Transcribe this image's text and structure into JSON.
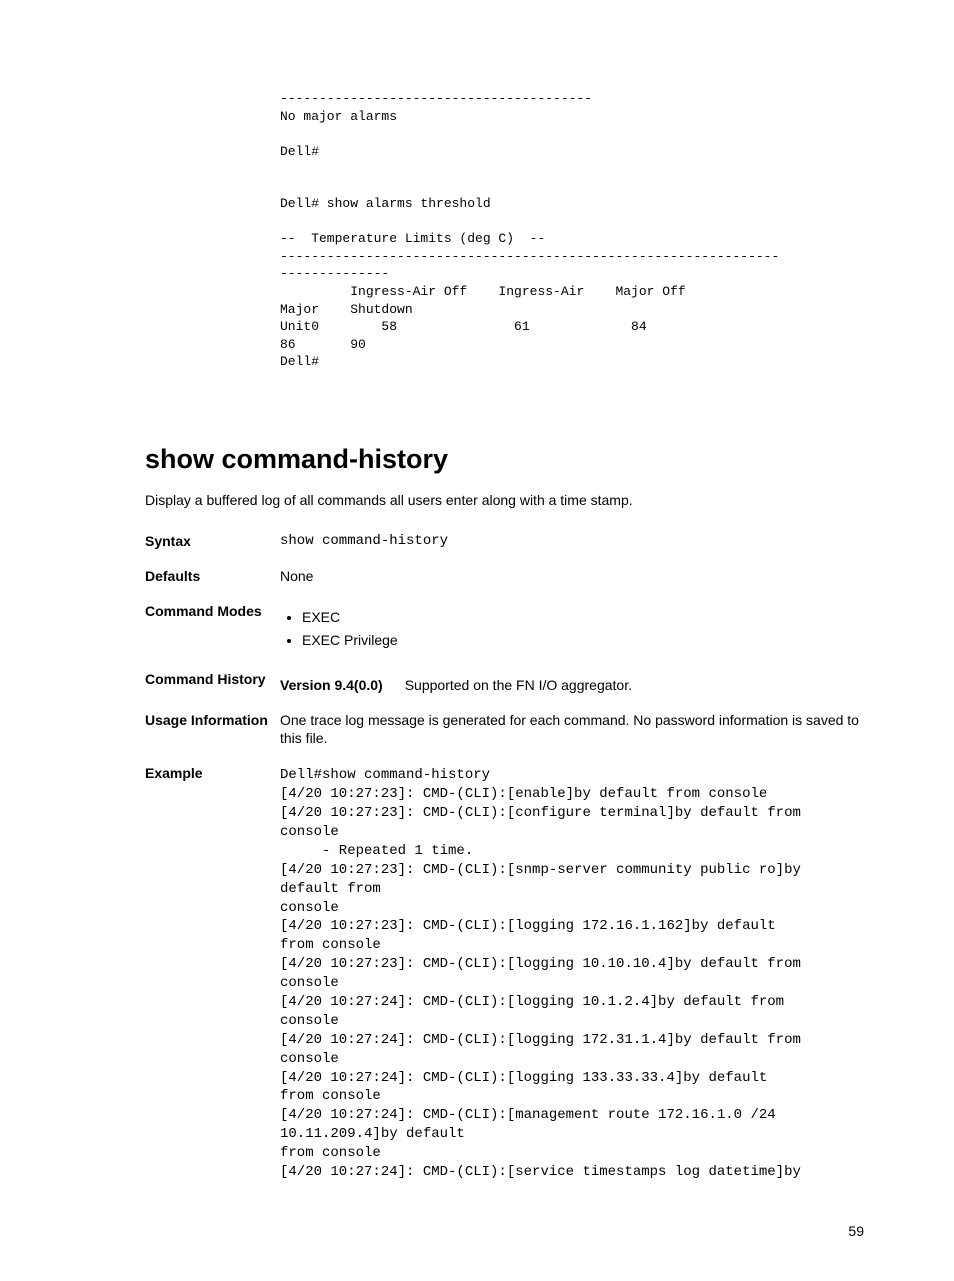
{
  "top_example": "----------------------------------------\nNo major alarms\n\nDell#\n\n\nDell# show alarms threshold\n\n--  Temperature Limits (deg C)  --\n----------------------------------------------------------------\n--------------\n         Ingress-Air Off    Ingress-Air    Major Off    \nMajor    Shutdown\nUnit0        58               61             84         \n86       90\nDell#",
  "section": {
    "title": "show command-history",
    "description": "Display a buffered log of all commands all users enter along with a time stamp."
  },
  "defs": {
    "syntax_label": "Syntax",
    "syntax_value": "show command-history",
    "defaults_label": "Defaults",
    "defaults_value": "None",
    "modes_label": "Command Modes",
    "modes_items": [
      "EXEC",
      "EXEC Privilege"
    ],
    "history_label": "Command History",
    "history_version": "Version 9.4(0.0)",
    "history_desc": "Supported on the FN I/O aggregator.",
    "usage_label": "Usage Information",
    "usage_value": "One trace log message is generated for each command. No password information is saved to this file.",
    "example_label": "Example",
    "example_value": "Dell#show command-history\n[4/20 10:27:23]: CMD-(CLI):[enable]by default from console\n[4/20 10:27:23]: CMD-(CLI):[configure terminal]by default from \nconsole\n     - Repeated 1 time.\n[4/20 10:27:23]: CMD-(CLI):[snmp-server community public ro]by \ndefault from\nconsole\n[4/20 10:27:23]: CMD-(CLI):[logging 172.16.1.162]by default \nfrom console\n[4/20 10:27:23]: CMD-(CLI):[logging 10.10.10.4]by default from \nconsole\n[4/20 10:27:24]: CMD-(CLI):[logging 10.1.2.4]by default from \nconsole\n[4/20 10:27:24]: CMD-(CLI):[logging 172.31.1.4]by default from \nconsole\n[4/20 10:27:24]: CMD-(CLI):[logging 133.33.33.4]by default \nfrom console\n[4/20 10:27:24]: CMD-(CLI):[management route 172.16.1.0 /24 \n10.11.209.4]by default\nfrom console\n[4/20 10:27:24]: CMD-(CLI):[service timestamps log datetime]by "
  },
  "page_number": "59"
}
